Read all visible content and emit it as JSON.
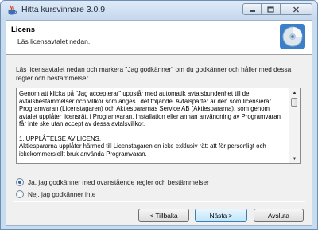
{
  "window": {
    "title": "Hitta kursvinnare 3.0.9",
    "app_icon": "java-cup-icon",
    "controls": [
      "minimize-icon",
      "maximize-icon",
      "close-icon"
    ]
  },
  "header": {
    "title": "Licens",
    "subtitle": "Läs licensavtalet nedan.",
    "icon": "cd-disc-icon"
  },
  "instructions": "Läs licensavtalet nedan och markera \"Jag godkänner\" om du godkänner och håller med dessa regler och bestämmelser.",
  "license": {
    "paragraphs": [
      "Genom att klicka på \"Jag accepterar\" uppstår med automatik avtalsbundenhet till de avtalsbestämmelser och villkor som anges i det följande. Avtalsparter är den som licensierar Programvaran (Licenstagaren) och Aktiespararnas Service AB (Aktiespararna), som genom avtalet upplåter licensrätt i Programvaran. Installation eller annan användning av Programvaran får inte ske utan accept av dessa avtalsvillkor.",
      "1. UPPLÅTELSE AV LICENS.",
      "Aktiespararna upplåter härmed till Licenstagaren en icke exklusiv rätt att för personligt och ickekommersiellt bruk använda Programvaran."
    ]
  },
  "options": {
    "accept_label": "Ja, jag godkänner med ovanstående regler och bestämmelser",
    "decline_label": "Nej, jag godkänner inte",
    "selected": "accept"
  },
  "buttons": {
    "back": "< Tillbaka",
    "next": "Nästa >",
    "cancel": "Avsluta"
  }
}
